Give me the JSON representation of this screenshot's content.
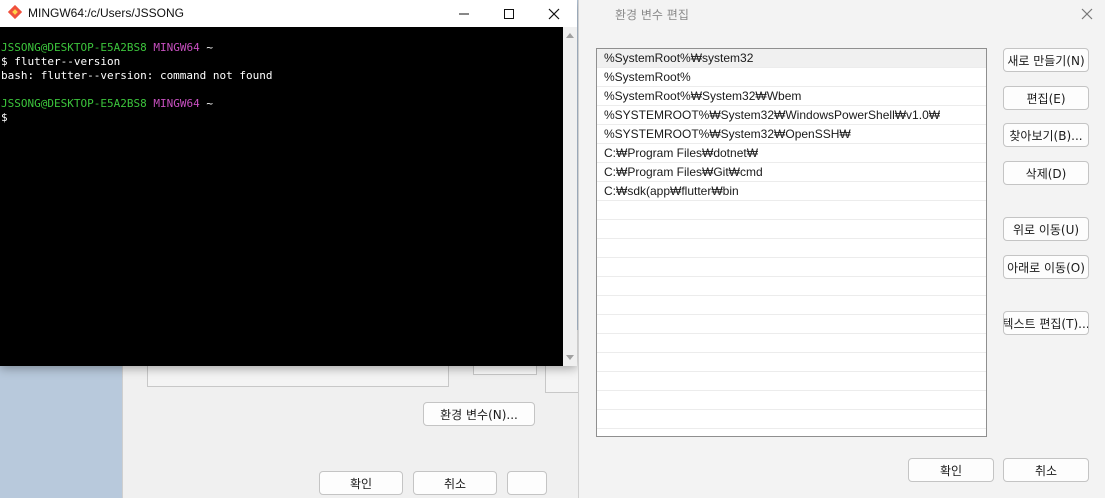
{
  "background_window": {
    "env_vars_button": "환경 변수(N)...",
    "ok_button": "확인",
    "cancel_button": "취소"
  },
  "terminal": {
    "title": "MINGW64:/c/Users/JSSONG",
    "lines": [
      {
        "user": "JSSONG@DESKTOP-E5A2BS8",
        "shell": "MINGW64",
        "path": "~"
      },
      {
        "text": "$ flutter--version"
      },
      {
        "text": "bash: flutter--version: command not found"
      },
      {
        "text": ""
      },
      {
        "user": "JSSONG@DESKTOP-E5A2BS8",
        "shell": "MINGW64",
        "path": "~"
      },
      {
        "text": "$"
      }
    ],
    "colors": {
      "user": "#3cc43c",
      "shell": "#c850c0",
      "background": "#000000"
    }
  },
  "env_editor": {
    "title": "환경 변수 편집",
    "entries": [
      "%SystemRoot%₩system32",
      "%SystemRoot%",
      "%SystemRoot%₩System32₩Wbem",
      "%SYSTEMROOT%₩System32₩WindowsPowerShell₩v1.0₩",
      "%SYSTEMROOT%₩System32₩OpenSSH₩",
      "C:₩Program Files₩dotnet₩",
      "C:₩Program Files₩Git₩cmd",
      "C:₩sdk(app₩flutter₩bin",
      "",
      "",
      "",
      "",
      "",
      "",
      "",
      "",
      "",
      "",
      "",
      ""
    ],
    "buttons": {
      "new": "새로 만들기(N)",
      "edit": "편집(E)",
      "browse": "찾아보기(B)...",
      "delete": "삭제(D)",
      "move_up": "위로 이동(U)",
      "move_down": "아래로 이동(O)",
      "edit_text": "텍스트 편집(T)...",
      "ok": "확인",
      "cancel": "취소"
    }
  }
}
